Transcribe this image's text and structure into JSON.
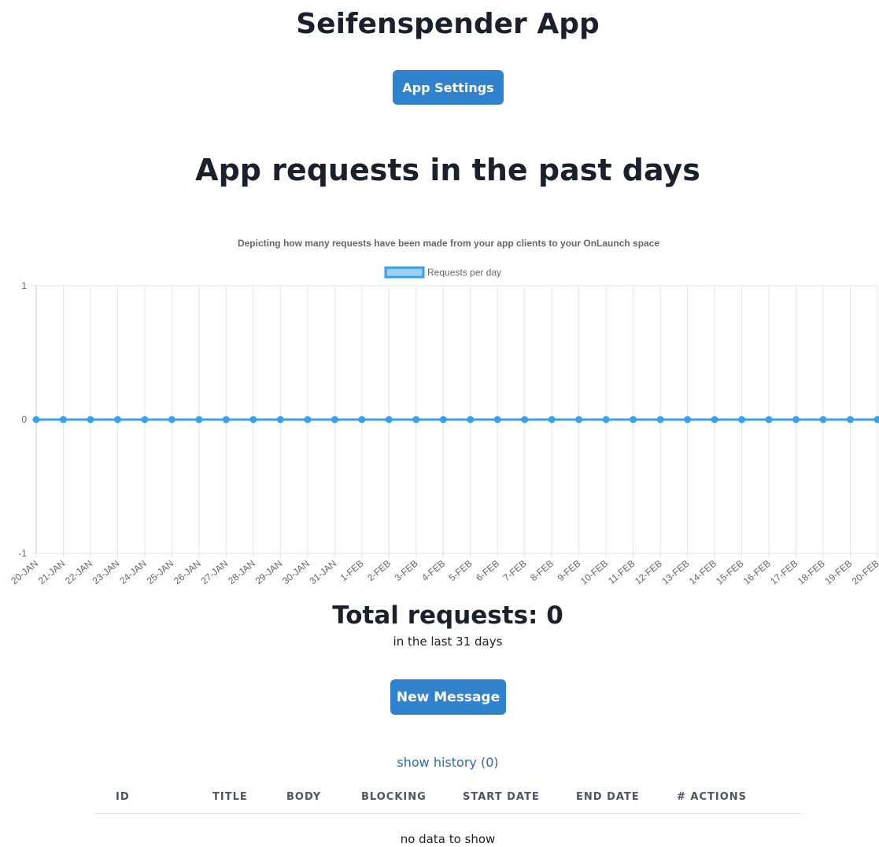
{
  "header": {
    "app_title": "Seifenspender App",
    "settings_label": "App Settings"
  },
  "requests": {
    "section_title": "App requests in the past days",
    "total_label": "Total requests: 0",
    "total_sub": "in the last 31 days"
  },
  "chart_data": {
    "type": "line",
    "title": "Depicting how many requests have been made from your app clients to your OnLaunch space",
    "legend_position": "top",
    "grid": true,
    "ylim": [
      -1,
      1
    ],
    "y_ticks": [
      "1",
      "0",
      "-1"
    ],
    "categories": [
      "20-JAN",
      "21-JAN",
      "22-JAN",
      "23-JAN",
      "24-JAN",
      "25-JAN",
      "26-JAN",
      "27-JAN",
      "28-JAN",
      "29-JAN",
      "30-JAN",
      "31-JAN",
      "1-FEB",
      "2-FEB",
      "3-FEB",
      "4-FEB",
      "5-FEB",
      "6-FEB",
      "7-FEB",
      "8-FEB",
      "9-FEB",
      "10-FEB",
      "11-FEB",
      "12-FEB",
      "13-FEB",
      "14-FEB",
      "15-FEB",
      "16-FEB",
      "17-FEB",
      "18-FEB",
      "19-FEB",
      "20-FEB"
    ],
    "series": [
      {
        "name": "Requests per day",
        "color": "#36a2eb",
        "values": [
          0,
          0,
          0,
          0,
          0,
          0,
          0,
          0,
          0,
          0,
          0,
          0,
          0,
          0,
          0,
          0,
          0,
          0,
          0,
          0,
          0,
          0,
          0,
          0,
          0,
          0,
          0,
          0,
          0,
          0,
          0,
          0
        ]
      }
    ]
  },
  "messages": {
    "new_message_label": "New Message",
    "history_label": "show history (0)",
    "columns": [
      "ID",
      "TITLE",
      "BODY",
      "BLOCKING",
      "START DATE",
      "END DATE",
      "# ACTIONS"
    ],
    "empty_text": "no data to show"
  }
}
